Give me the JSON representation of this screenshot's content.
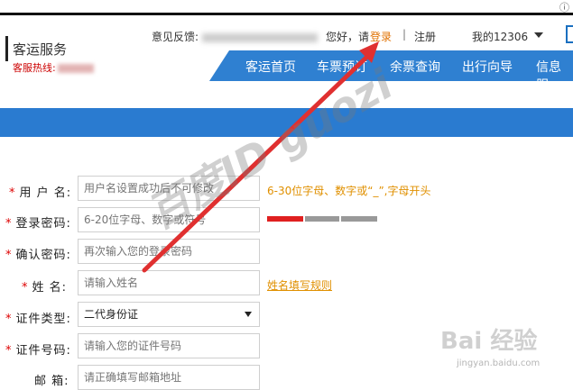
{
  "header": {
    "brand_title": "客运服务",
    "hotline_label": "客服热线:",
    "feedback_label": "意见反馈:",
    "greeting": "您好，请",
    "login": "登录",
    "separator": "|",
    "register": "注册",
    "my_account": "我的12306"
  },
  "nav": {
    "items": [
      "客运首页",
      "车票预订",
      "余票查询",
      "出行向导",
      "信息服"
    ]
  },
  "form": {
    "username": {
      "label": "用 户 名:",
      "placeholder": "用户名设置成功后不可修改",
      "hint": "6-30位字母、数字或“_”,字母开头"
    },
    "password": {
      "label": "登录密码:",
      "placeholder": "6-20位字母、数字或符号"
    },
    "confirm": {
      "label": "确认密码:",
      "placeholder": "再次输入您的登录密码"
    },
    "name": {
      "label": "姓  名:",
      "placeholder": "请输入姓名",
      "link": "姓名填写规则"
    },
    "id_type": {
      "label": "证件类型:",
      "value": "二代身份证"
    },
    "id_number": {
      "label": "证件号码:",
      "placeholder": "请输入您的证件号码"
    },
    "email": {
      "label": "邮  箱:",
      "placeholder": "请正确填写邮箱地址"
    },
    "password_strength": {
      "level": 1,
      "max": 3
    }
  },
  "watermark": {
    "text": "百度ID guozi",
    "baidu": "Bai 经验",
    "url": "jingyan.baidu.com"
  },
  "colors": {
    "accent_blue": "#2f80d1",
    "required_star": "#d00000",
    "hint_orange": "#e09000",
    "annotation_red": "#e03030"
  }
}
